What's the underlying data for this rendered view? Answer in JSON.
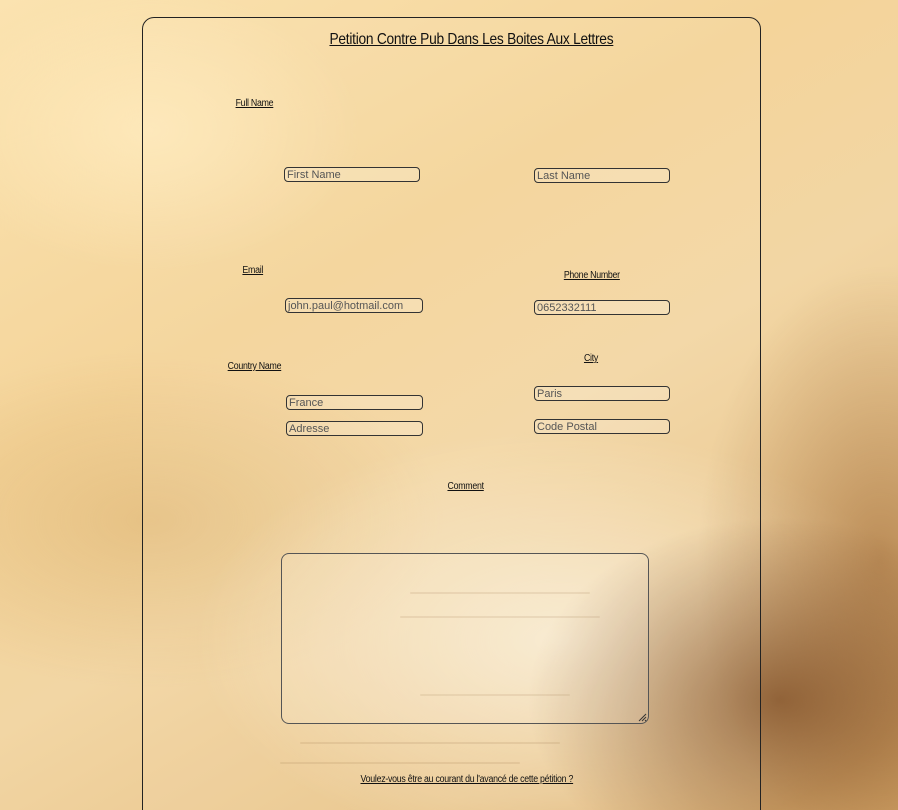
{
  "form": {
    "title": "Petition Contre Pub Dans Les Boites Aux Lettres",
    "full_name": {
      "label": "Full Name",
      "first_placeholder": "First Name",
      "last_placeholder": "Last Name"
    },
    "email": {
      "label": "Email",
      "placeholder": "john.paul@hotmail.com"
    },
    "phone": {
      "label": "Phone Number",
      "placeholder": "0652332111"
    },
    "country": {
      "label": "Country Name",
      "placeholder": "France",
      "address_placeholder": "Adresse"
    },
    "city": {
      "label": "City",
      "placeholder": "Paris",
      "postal_placeholder": "Code Postal"
    },
    "comment": {
      "label": "Comment"
    },
    "subscribe_question": "Voulez-vous être au courant du l'avancé de cette pétition ?"
  }
}
